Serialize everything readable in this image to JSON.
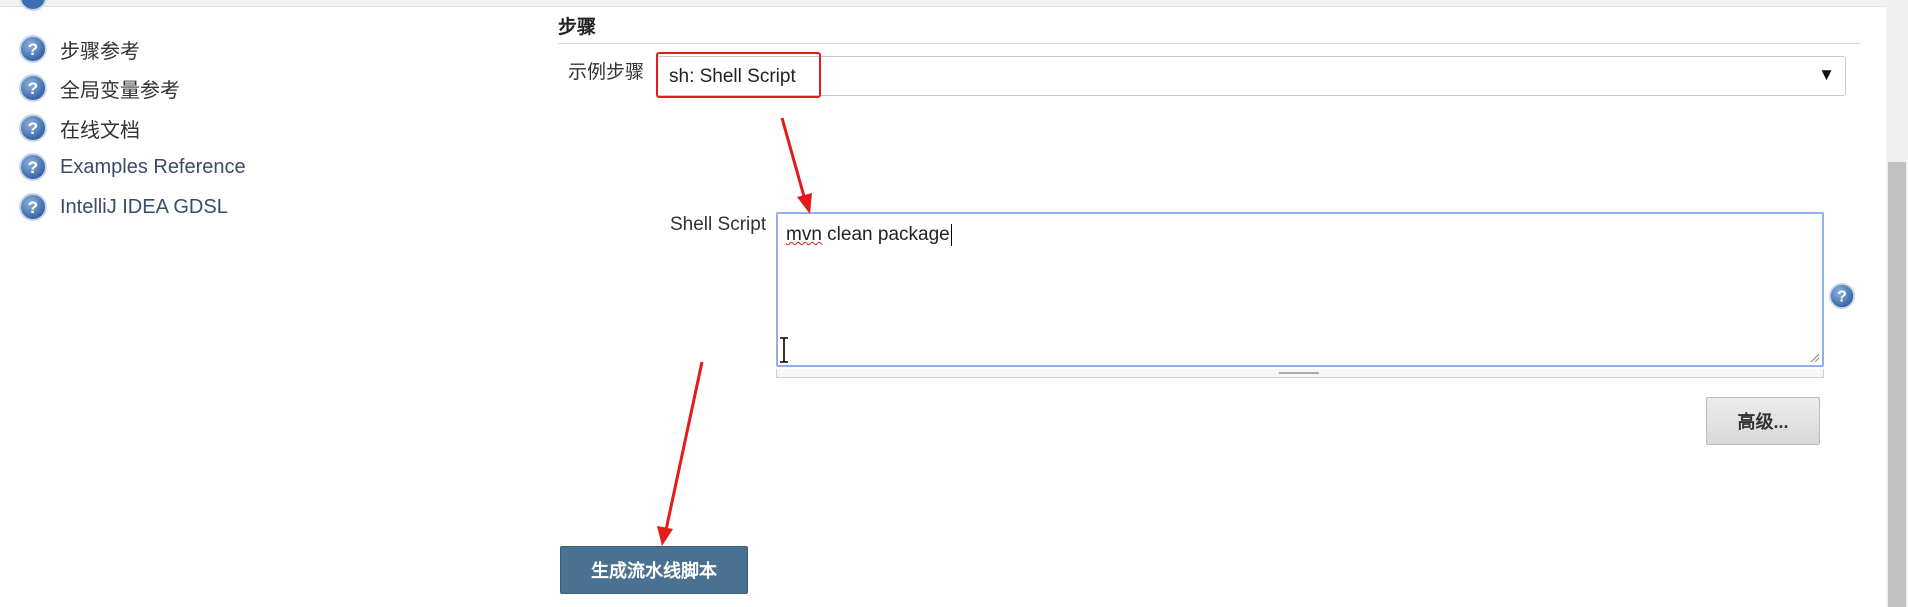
{
  "sidebar": {
    "items": [
      {
        "label": "步骤参考",
        "icon": "help-icon"
      },
      {
        "label": "全局变量参考",
        "icon": "help-icon"
      },
      {
        "label": "在线文档",
        "icon": "help-icon"
      },
      {
        "label": "Examples Reference",
        "icon": "help-icon"
      },
      {
        "label": "IntelliJ IDEA GDSL",
        "icon": "help-icon"
      }
    ]
  },
  "main": {
    "section_title": "步骤",
    "sample_step": {
      "label": "示例步骤",
      "selected": "sh: Shell Script"
    },
    "shell_script": {
      "label": "Shell Script",
      "value_word1": "mvn",
      "value_rest": " clean package"
    },
    "advanced_button": "高级...",
    "generate_button": "生成流水线脚本"
  },
  "colors": {
    "annotation": "#e41b1b",
    "primary_button": "#4a7290",
    "textarea_focus": "#8fb0e8"
  }
}
